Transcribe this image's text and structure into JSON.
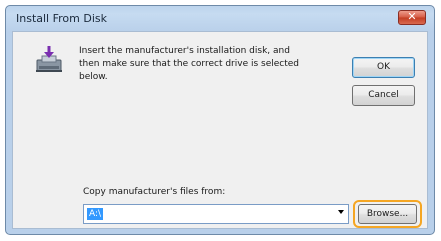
{
  "window": {
    "title": "Install From Disk",
    "close_glyph": "✕"
  },
  "message": {
    "text": "Insert the manufacturer's installation disk, and then make sure that the correct drive is selected below."
  },
  "buttons": {
    "ok_label": "OK",
    "cancel_label": "Cancel",
    "browse_label": "Browse..."
  },
  "copy_from": {
    "label": "Copy manufacturer's files from:",
    "value": "A:\\"
  },
  "icons": {
    "dialog_icon": "install-disk-icon",
    "dropdown": "chevron-down-icon"
  },
  "colors": {
    "highlight_ring": "#f5a623",
    "selection": "#3399ff",
    "close_button": "#c33c22"
  }
}
